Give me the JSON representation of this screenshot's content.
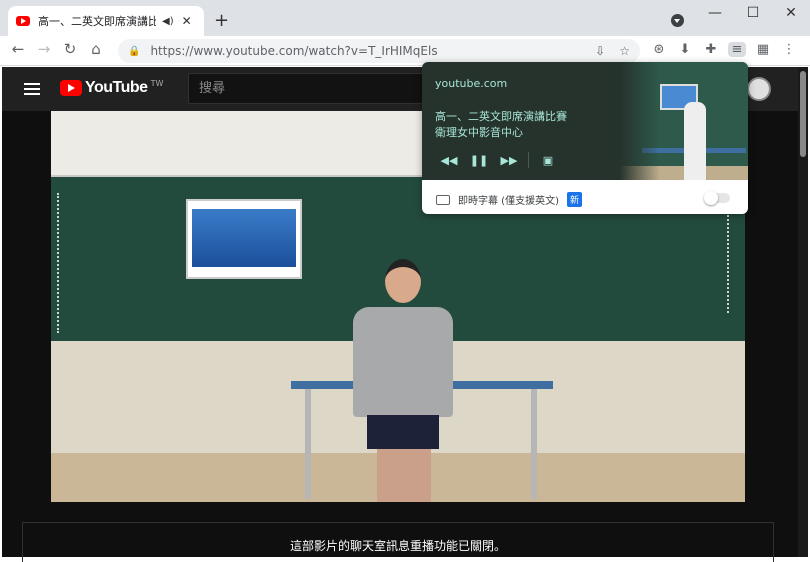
{
  "tab": {
    "title": "高一、二英文即席演講比賽 -",
    "audio_icon": "speaker-icon",
    "close": "✕"
  },
  "new_tab": "+",
  "window_controls": {
    "minimize": "—",
    "maximize": "☐",
    "close": "✕"
  },
  "toolbar": {
    "back": "←",
    "forward": "→",
    "reload": "↻",
    "home": "⌂"
  },
  "omnibox": {
    "lock": "🔒",
    "url": "https://www.youtube.com/watch?v=T_IrHIMqEls",
    "install": "⇩",
    "star": "☆"
  },
  "extensions": [
    "⊛",
    "⬇",
    "✚",
    "≡",
    "▦",
    "⋮"
  ],
  "youtube": {
    "logo_text": "YouTube",
    "region": "TW",
    "search_placeholder": "搜尋"
  },
  "chat_notice": "這部影片的聊天室訊息重播功能已關閉。",
  "media_popup": {
    "site": "youtube.com",
    "title_line1": "高一、二英文即席演講比賽",
    "title_line2": "衛理女中影音中心",
    "prev": "◀◀",
    "pause": "❚❚",
    "next": "▶▶",
    "pip": "▣",
    "caption_label": "即時字幕 (僅支援英文)",
    "caption_badge": "新",
    "caption_enabled": false
  },
  "colors": {
    "yt_red": "#ff0000",
    "popup_bg": "#26332d",
    "popup_text": "#a8e6d8",
    "badge_blue": "#1a73e8"
  }
}
